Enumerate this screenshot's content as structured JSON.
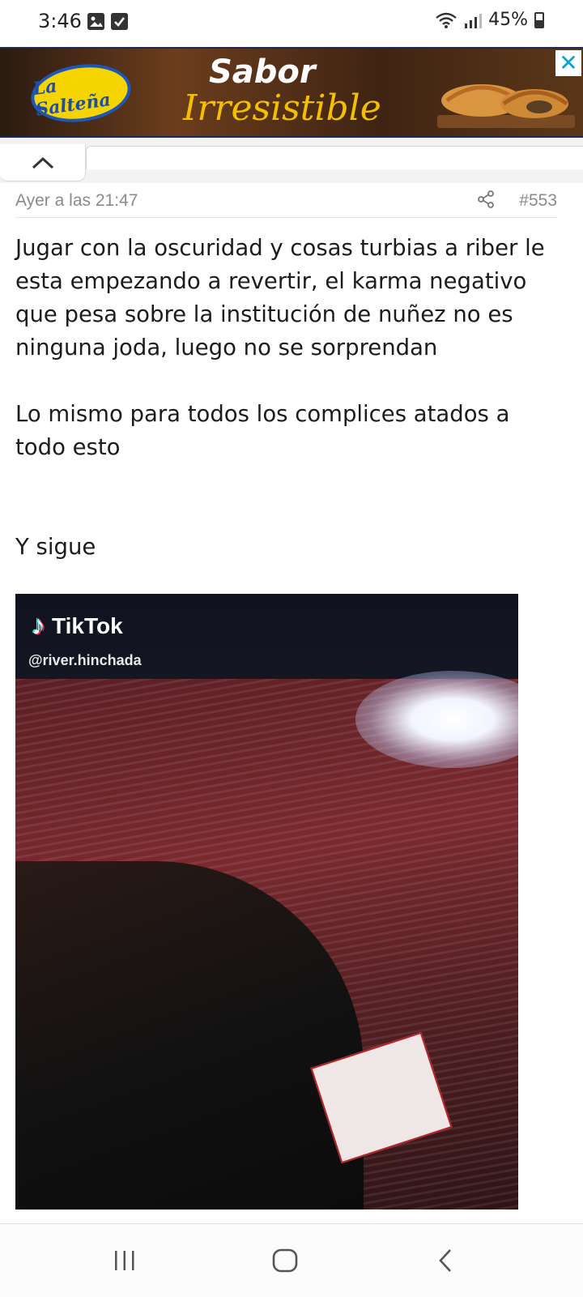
{
  "status_bar": {
    "time": "3:46",
    "battery": "45%",
    "icons": [
      "gallery-icon",
      "check-box-icon",
      "wifi-icon",
      "signal-icon",
      "battery-icon"
    ]
  },
  "ad": {
    "brand": "La Salteña",
    "headline_1": "Sabor",
    "headline_2": "Irresistible",
    "close_label": "✕"
  },
  "post": {
    "date": "Ayer a las 21:47",
    "number": "#553",
    "paragraphs": [
      "Jugar con la oscuridad y cosas turbias a riber le esta empezando a revertir, el karma negativo que pesa sobre la institución de nuñez no es ninguna joda, luego no se sorprendan",
      "Lo mismo para todos los complices atados a todo esto",
      "Y sigue"
    ],
    "embed": {
      "brand": "TikTok",
      "handle": "@river.hinchada"
    }
  },
  "colors": {
    "accent_blue": "#1e57b8",
    "ad_yellow": "#f3c000",
    "meta_gray": "#8a8a8a"
  }
}
